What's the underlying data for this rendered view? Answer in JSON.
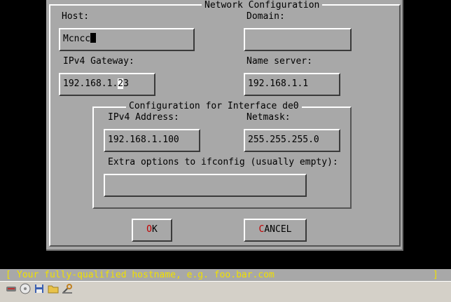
{
  "dialog": {
    "title": "Network Configuration",
    "host_label": "Host:",
    "host_value": "Mcncc",
    "domain_label": "Domain:",
    "domain_value": "",
    "gateway_label": "IPv4 Gateway:",
    "gateway_value_pre": "192.168.1.",
    "gateway_value_cursor": "2",
    "gateway_value_post": "3",
    "nameserver_label": "Name server:",
    "nameserver_value": "192.168.1.1"
  },
  "interface_group": {
    "title": "Configuration for Interface de0",
    "ipv4_label": "IPv4 Address:",
    "ipv4_value": "192.168.1.100",
    "netmask_label": "Netmask:",
    "netmask_value": "255.255.255.0",
    "extra_label": "Extra options to ifconfig (usually empty):",
    "extra_value": ""
  },
  "buttons": {
    "ok_hot": "O",
    "ok_rest": "K",
    "cancel_hot": "C",
    "cancel_rest": "ANCEL"
  },
  "status_bar": {
    "open_bracket": "[",
    "text": "Your fully-qualified hostname, e.g. foo.bar.com",
    "close_bracket": "]"
  },
  "taskbar": {
    "icons": [
      "disk-icon",
      "cdrom-icon",
      "save-icon",
      "folder-icon",
      "tool-icon"
    ]
  },
  "colors": {
    "dialog_bg": "#a8a8a8",
    "status_text": "#f0e000",
    "hotkey": "#c00000"
  }
}
